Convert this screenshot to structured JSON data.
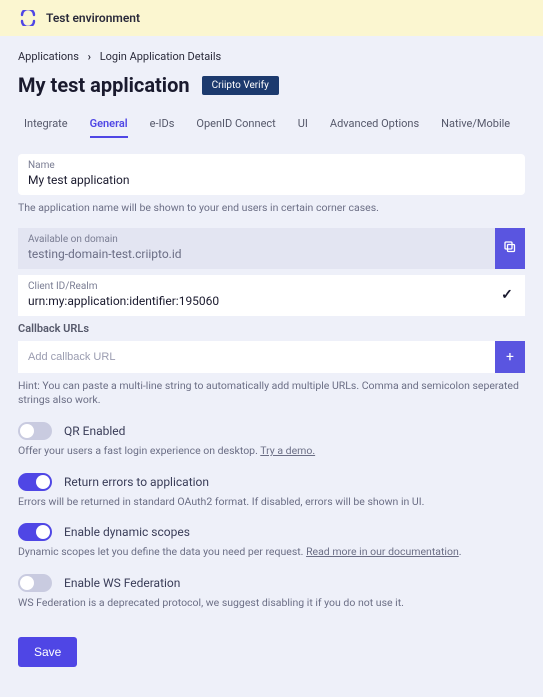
{
  "banner": {
    "text": "Test environment"
  },
  "breadcrumb": {
    "root": "Applications",
    "current": "Login Application Details"
  },
  "header": {
    "title": "My test application",
    "badge": "Criipto Verify"
  },
  "tabs": [
    {
      "label": "Integrate",
      "active": false
    },
    {
      "label": "General",
      "active": true
    },
    {
      "label": "e-IDs",
      "active": false
    },
    {
      "label": "OpenID Connect",
      "active": false
    },
    {
      "label": "UI",
      "active": false
    },
    {
      "label": "Advanced Options",
      "active": false
    },
    {
      "label": "Native/Mobile",
      "active": false
    }
  ],
  "fields": {
    "name": {
      "label": "Name",
      "value": "My test application",
      "help": "The application name will be shown to your end users in certain corner cases."
    },
    "domain": {
      "label": "Available on domain",
      "value": "testing-domain-test.criipto.id"
    },
    "client": {
      "label": "Client ID/Realm",
      "value": "urn:my:application:identifier:195060"
    }
  },
  "callback": {
    "heading": "Callback URLs",
    "placeholder": "Add callback URL",
    "hint": "Hint: You can paste a multi-line string to automatically add multiple URLs. Comma and semicolon seperated strings also work."
  },
  "toggles": {
    "qr": {
      "label": "QR Enabled",
      "on": false,
      "desc_prefix": "Offer your users a fast login experience on desktop. ",
      "link": "Try a demo."
    },
    "errors": {
      "label": "Return errors to application",
      "on": true,
      "desc": "Errors will be returned in standard OAuth2 format. If disabled, errors will be shown in UI."
    },
    "scopes": {
      "label": "Enable dynamic scopes",
      "on": true,
      "desc_prefix": "Dynamic scopes let you define the data you need per request. ",
      "link": "Read more in our documentation",
      "desc_suffix": "."
    },
    "wsfed": {
      "label": "Enable WS Federation",
      "on": false,
      "desc": "WS Federation is a deprecated protocol, we suggest disabling it if you do not use it."
    }
  },
  "actions": {
    "save": "Save"
  },
  "icons": {
    "plus": "+",
    "check": "✓"
  }
}
